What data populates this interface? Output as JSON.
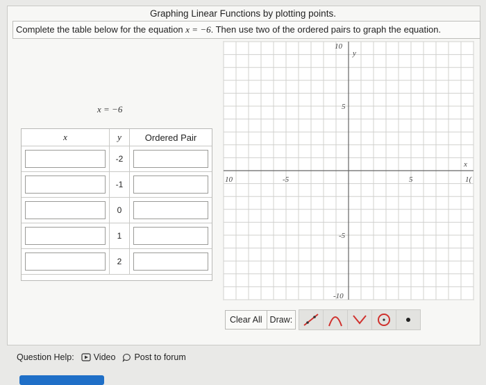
{
  "title": "Graphing Linear Functions by plotting points.",
  "instructions": {
    "before": "Complete the table below for the equation ",
    "equation": "x = −6",
    "after": ". Then use two of the ordered pairs to graph the equation."
  },
  "equation_label": "x = −6",
  "table": {
    "headers": [
      "x",
      "y",
      "Ordered Pair"
    ],
    "rows": [
      {
        "x": "",
        "y": "-2",
        "pair": ""
      },
      {
        "x": "",
        "y": "-1",
        "pair": ""
      },
      {
        "x": "",
        "y": "0",
        "pair": ""
      },
      {
        "x": "",
        "y": "1",
        "pair": ""
      },
      {
        "x": "",
        "y": "2",
        "pair": ""
      }
    ]
  },
  "graph": {
    "xmin": -10,
    "xmax": 10,
    "ymin": -10,
    "ymax": 10,
    "x_axis_label": "x",
    "y_axis_label": "y",
    "tick_labels": {
      "x_neg10": "10",
      "x_neg5": "-5",
      "x_5": "5",
      "x_10": "1(",
      "y_10": "10",
      "y_5": "5",
      "y_neg5": "-5",
      "y_neg10": "-10"
    }
  },
  "toolbar": {
    "clear_all": "Clear All",
    "draw_label": "Draw:",
    "tools": [
      "line-tool-icon",
      "parabola-tool-icon",
      "absolute-value-tool-icon",
      "circle-tool-icon",
      "point-tool-icon"
    ]
  },
  "help": {
    "label": "Question Help:",
    "video": "Video",
    "forum": "Post to forum"
  },
  "colors": {
    "accent": "#1f6fc7",
    "tool_red": "#d0312d",
    "grid": "#d0d0ce"
  }
}
